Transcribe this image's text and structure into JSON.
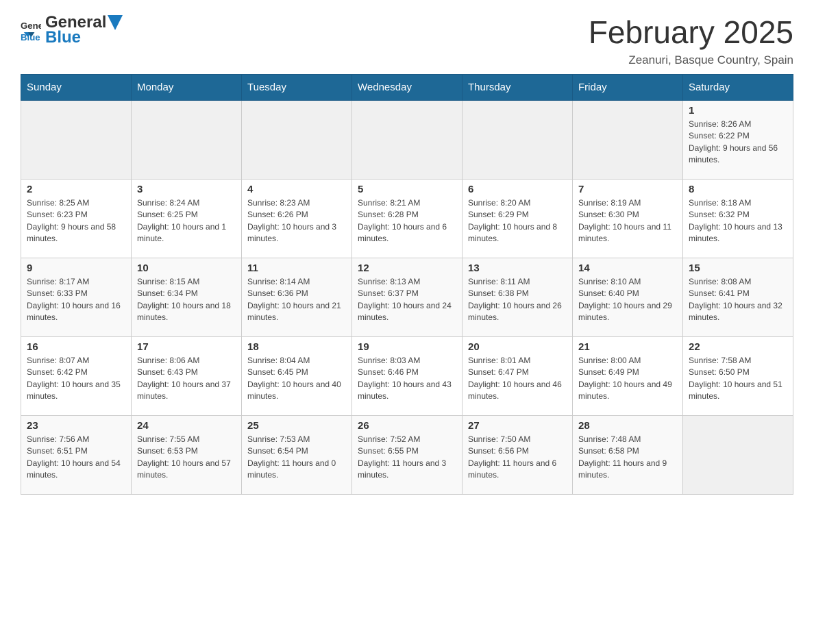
{
  "header": {
    "logo_general": "General",
    "logo_blue": "Blue",
    "title": "February 2025",
    "location": "Zeanuri, Basque Country, Spain"
  },
  "days_of_week": [
    "Sunday",
    "Monday",
    "Tuesday",
    "Wednesday",
    "Thursday",
    "Friday",
    "Saturday"
  ],
  "weeks": [
    {
      "days": [
        {
          "num": "",
          "info": ""
        },
        {
          "num": "",
          "info": ""
        },
        {
          "num": "",
          "info": ""
        },
        {
          "num": "",
          "info": ""
        },
        {
          "num": "",
          "info": ""
        },
        {
          "num": "",
          "info": ""
        },
        {
          "num": "1",
          "info": "Sunrise: 8:26 AM\nSunset: 6:22 PM\nDaylight: 9 hours and 56 minutes."
        }
      ]
    },
    {
      "days": [
        {
          "num": "2",
          "info": "Sunrise: 8:25 AM\nSunset: 6:23 PM\nDaylight: 9 hours and 58 minutes."
        },
        {
          "num": "3",
          "info": "Sunrise: 8:24 AM\nSunset: 6:25 PM\nDaylight: 10 hours and 1 minute."
        },
        {
          "num": "4",
          "info": "Sunrise: 8:23 AM\nSunset: 6:26 PM\nDaylight: 10 hours and 3 minutes."
        },
        {
          "num": "5",
          "info": "Sunrise: 8:21 AM\nSunset: 6:28 PM\nDaylight: 10 hours and 6 minutes."
        },
        {
          "num": "6",
          "info": "Sunrise: 8:20 AM\nSunset: 6:29 PM\nDaylight: 10 hours and 8 minutes."
        },
        {
          "num": "7",
          "info": "Sunrise: 8:19 AM\nSunset: 6:30 PM\nDaylight: 10 hours and 11 minutes."
        },
        {
          "num": "8",
          "info": "Sunrise: 8:18 AM\nSunset: 6:32 PM\nDaylight: 10 hours and 13 minutes."
        }
      ]
    },
    {
      "days": [
        {
          "num": "9",
          "info": "Sunrise: 8:17 AM\nSunset: 6:33 PM\nDaylight: 10 hours and 16 minutes."
        },
        {
          "num": "10",
          "info": "Sunrise: 8:15 AM\nSunset: 6:34 PM\nDaylight: 10 hours and 18 minutes."
        },
        {
          "num": "11",
          "info": "Sunrise: 8:14 AM\nSunset: 6:36 PM\nDaylight: 10 hours and 21 minutes."
        },
        {
          "num": "12",
          "info": "Sunrise: 8:13 AM\nSunset: 6:37 PM\nDaylight: 10 hours and 24 minutes."
        },
        {
          "num": "13",
          "info": "Sunrise: 8:11 AM\nSunset: 6:38 PM\nDaylight: 10 hours and 26 minutes."
        },
        {
          "num": "14",
          "info": "Sunrise: 8:10 AM\nSunset: 6:40 PM\nDaylight: 10 hours and 29 minutes."
        },
        {
          "num": "15",
          "info": "Sunrise: 8:08 AM\nSunset: 6:41 PM\nDaylight: 10 hours and 32 minutes."
        }
      ]
    },
    {
      "days": [
        {
          "num": "16",
          "info": "Sunrise: 8:07 AM\nSunset: 6:42 PM\nDaylight: 10 hours and 35 minutes."
        },
        {
          "num": "17",
          "info": "Sunrise: 8:06 AM\nSunset: 6:43 PM\nDaylight: 10 hours and 37 minutes."
        },
        {
          "num": "18",
          "info": "Sunrise: 8:04 AM\nSunset: 6:45 PM\nDaylight: 10 hours and 40 minutes."
        },
        {
          "num": "19",
          "info": "Sunrise: 8:03 AM\nSunset: 6:46 PM\nDaylight: 10 hours and 43 minutes."
        },
        {
          "num": "20",
          "info": "Sunrise: 8:01 AM\nSunset: 6:47 PM\nDaylight: 10 hours and 46 minutes."
        },
        {
          "num": "21",
          "info": "Sunrise: 8:00 AM\nSunset: 6:49 PM\nDaylight: 10 hours and 49 minutes."
        },
        {
          "num": "22",
          "info": "Sunrise: 7:58 AM\nSunset: 6:50 PM\nDaylight: 10 hours and 51 minutes."
        }
      ]
    },
    {
      "days": [
        {
          "num": "23",
          "info": "Sunrise: 7:56 AM\nSunset: 6:51 PM\nDaylight: 10 hours and 54 minutes."
        },
        {
          "num": "24",
          "info": "Sunrise: 7:55 AM\nSunset: 6:53 PM\nDaylight: 10 hours and 57 minutes."
        },
        {
          "num": "25",
          "info": "Sunrise: 7:53 AM\nSunset: 6:54 PM\nDaylight: 11 hours and 0 minutes."
        },
        {
          "num": "26",
          "info": "Sunrise: 7:52 AM\nSunset: 6:55 PM\nDaylight: 11 hours and 3 minutes."
        },
        {
          "num": "27",
          "info": "Sunrise: 7:50 AM\nSunset: 6:56 PM\nDaylight: 11 hours and 6 minutes."
        },
        {
          "num": "28",
          "info": "Sunrise: 7:48 AM\nSunset: 6:58 PM\nDaylight: 11 hours and 9 minutes."
        },
        {
          "num": "",
          "info": ""
        }
      ]
    }
  ]
}
